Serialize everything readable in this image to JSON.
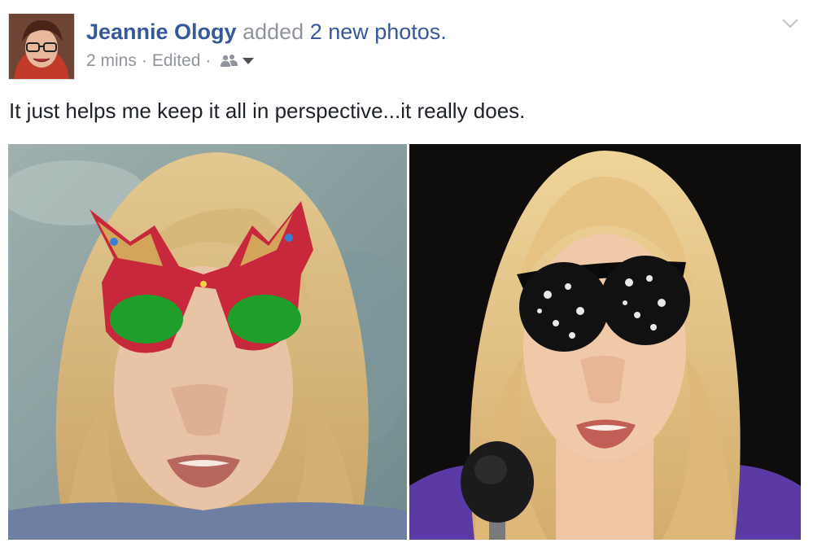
{
  "post": {
    "author": "Jeannie Ology",
    "verb": "added",
    "photos_link": "2 new photos.",
    "time": "2 mins",
    "edited": "Edited",
    "separator": "·",
    "privacy_icon": "friends-icon",
    "menu_icon": "chevron-down-icon",
    "message": "It just helps me keep it all in perspective...it really does."
  },
  "photos": [
    {
      "subject": "woman-with-sparkly-butterfly-sunglasses",
      "lens_color": "#1e9e2a",
      "frame_color": "#c8283c"
    },
    {
      "subject": "woman-with-skull-print-sunglasses-at-microphone",
      "lens_color": "#111111",
      "frame_color": "#0a0a0a"
    }
  ],
  "colors": {
    "link": "#365899",
    "meta": "#90949c",
    "text": "#1d2129"
  }
}
